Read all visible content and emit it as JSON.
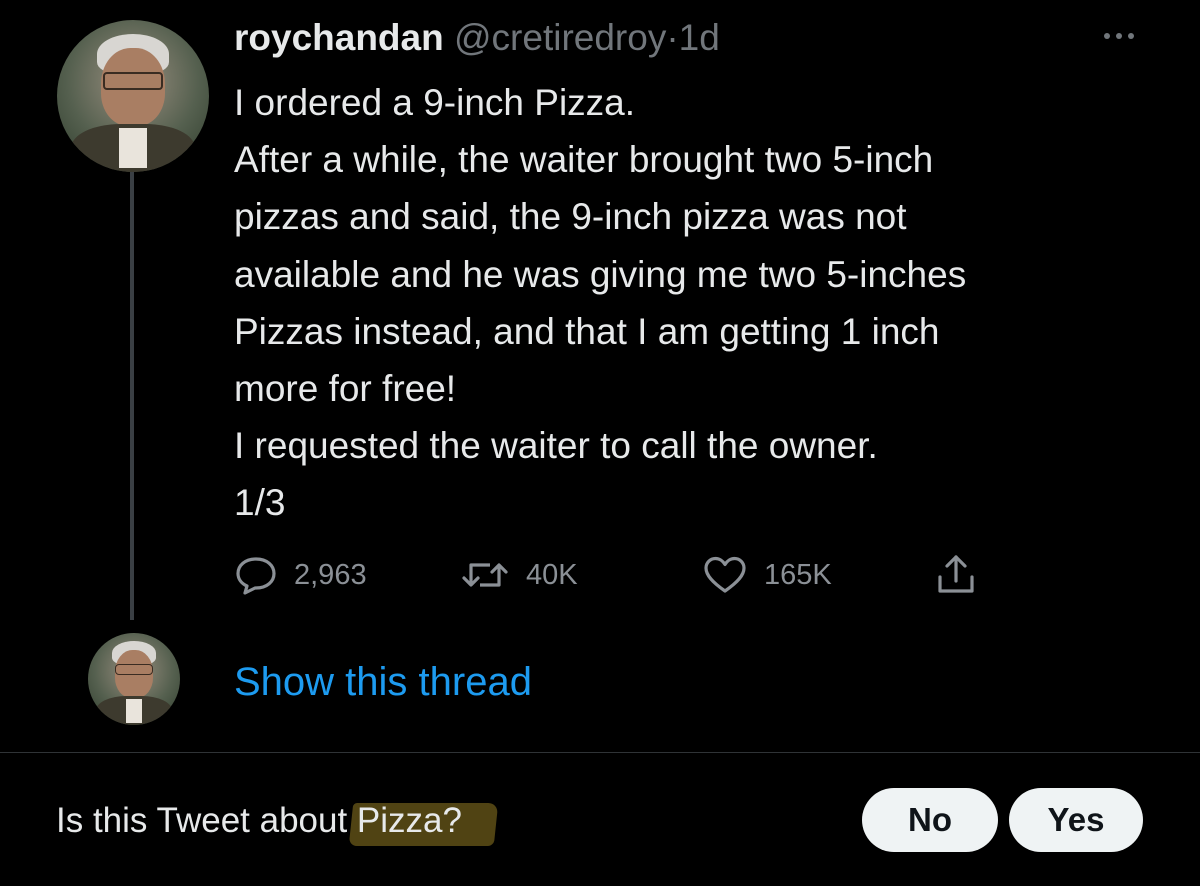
{
  "tweet": {
    "author_name": "roychandan",
    "handle": "@cretiredroy",
    "separator": "·",
    "time": "1d",
    "lines": [
      "I ordered a 9-inch Pizza.",
      "After a while, the waiter  brought two 5-inch",
      "pizzas and said, the 9-inch pizza was not",
      "available and he was giving me two 5-inches",
      "Pizzas instead, and that I am getting 1 inch",
      "more for free!",
      "I requested  the waiter to call the owner.",
      "1/3"
    ],
    "actions": {
      "replies": "2,963",
      "retweets": "40K",
      "likes": "165K"
    }
  },
  "thread": {
    "show_label": "Show this thread"
  },
  "topic_prompt": {
    "question_prefix": "Is this Tweet about ",
    "topic": "Pizza?",
    "no_label": "No",
    "yes_label": "Yes"
  },
  "icons": {
    "more": "more-horizontal-icon",
    "reply": "reply-icon",
    "retweet": "retweet-icon",
    "like": "heart-icon",
    "share": "share-icon"
  },
  "colors": {
    "background": "#000000",
    "text": "#e7e9ea",
    "secondary": "#71767b",
    "link": "#1d9bf0",
    "highlight": "#6b5a1a"
  }
}
